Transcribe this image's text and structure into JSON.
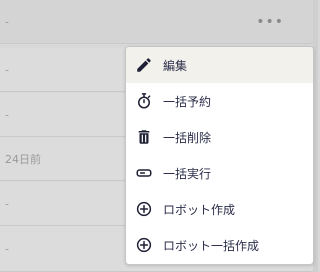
{
  "table": {
    "rows": [
      {
        "text": "-",
        "has_actions": true
      },
      {
        "text": "-"
      },
      {
        "text": "-"
      },
      {
        "text": "24日前"
      },
      {
        "text": "-"
      },
      {
        "text": "-"
      }
    ],
    "actions_label": "•••"
  },
  "context_menu": {
    "items": [
      {
        "label": "編集",
        "icon": "pencil-icon"
      },
      {
        "label": "一括予約",
        "icon": "stopwatch-icon"
      },
      {
        "label": "一括削除",
        "icon": "trash-icon"
      },
      {
        "label": "一括実行",
        "icon": "device-icon"
      },
      {
        "label": "ロボット作成",
        "icon": "plus-circle-icon"
      },
      {
        "label": "ロボット一括作成",
        "icon": "plus-circle-icon"
      }
    ]
  },
  "colors": {
    "menu_text": "#2b2d49",
    "menu_active_bg": "#f3f1ec",
    "row_bg": "#dcdcdc",
    "icon_dark": "#1f2035"
  }
}
